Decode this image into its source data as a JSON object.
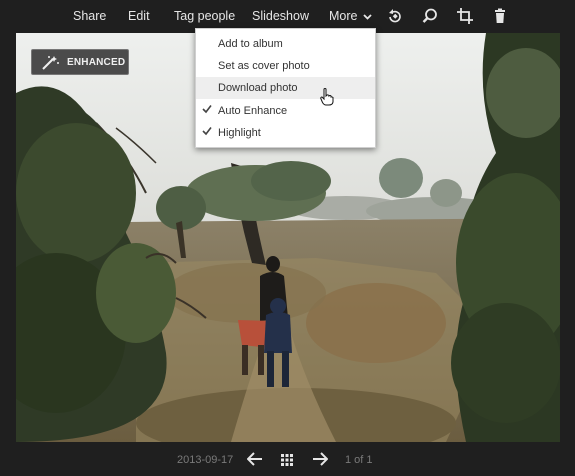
{
  "toolbar": {
    "share_label": "Share",
    "edit_label": "Edit",
    "tag_people_label": "Tag people",
    "slideshow_label": "Slideshow",
    "more_label": "More",
    "icons": [
      "rotate-icon",
      "zoom-icon",
      "crop-icon",
      "trash-icon"
    ]
  },
  "badge": {
    "label": "ENHANCED",
    "icon": "magic-wand-icon"
  },
  "more_menu": {
    "items": [
      {
        "label": "Add to album",
        "checked": false
      },
      {
        "label": "Set as cover photo",
        "checked": false
      },
      {
        "label": "Download photo",
        "checked": false,
        "hovered": true
      },
      {
        "label": "Auto Enhance",
        "checked": true
      },
      {
        "label": "Highlight",
        "checked": true
      }
    ]
  },
  "footer": {
    "date": "2013-09-17",
    "counter": "1 of 1",
    "icons": [
      "prev-arrow-icon",
      "grid-icon",
      "next-arrow-icon"
    ]
  },
  "colors": {
    "background": "#1f1f1f",
    "toolbar_text": "#e6e6e6",
    "menu_bg": "#ffffff",
    "menu_hover": "#eeeeee",
    "footer_text": "#7a7a7a"
  }
}
